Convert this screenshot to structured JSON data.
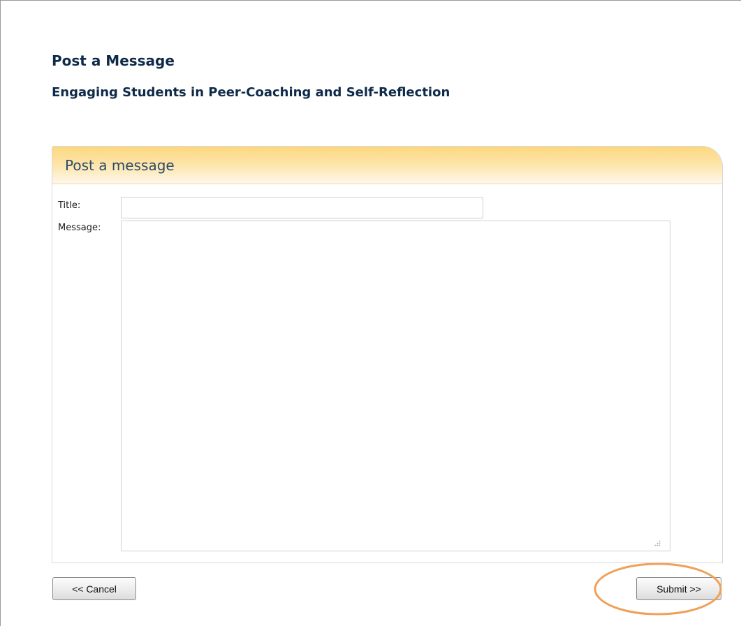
{
  "page": {
    "title": "Post a Message",
    "subtitle": "Engaging Students in Peer-Coaching and Self-Reflection"
  },
  "panel": {
    "header": "Post a message"
  },
  "form": {
    "title_label": "Title:",
    "title_value": "",
    "message_label": "Message:",
    "message_value": ""
  },
  "buttons": {
    "cancel": "<< Cancel",
    "submit": "Submit >>"
  },
  "colors": {
    "heading": "#0e2a49",
    "panel_header_gradient_top": "#fdd77f",
    "panel_header_text": "#2d4a66",
    "highlight_ellipse": "#f0a159"
  },
  "icons": {
    "resize_grip": "resize-grip-icon"
  }
}
